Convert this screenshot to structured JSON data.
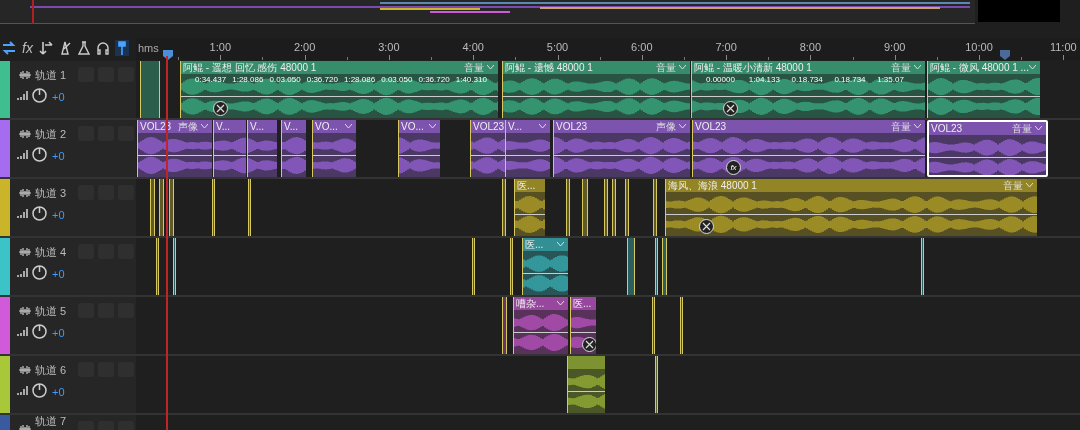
{
  "toolbar": {
    "fx_label": "fx"
  },
  "ruler": {
    "unit": "hms",
    "ticks": [
      "1:00",
      "2:00",
      "3:00",
      "4:00",
      "5:00",
      "6:00",
      "7:00",
      "8:00",
      "9:00",
      "10:00",
      "11:00"
    ]
  },
  "tracks": [
    {
      "name": "轨道 1",
      "color": "#3fbf8f",
      "volume": "+0",
      "clips": [
        {
          "label": "阿鲲 - 遥想 回忆 感伤 48000 1",
          "control": "音量",
          "selected": false,
          "markers": [
            "0:34.437",
            "1:28.086",
            "0.03.050",
            "0:36.720",
            "1:28.086",
            "0.03.050",
            "0:36.720",
            "1:40.310"
          ]
        },
        {
          "label": "阿鲲 - 遗憾 48000 1",
          "control": "音量",
          "selected": false
        },
        {
          "label": "阿鲲 - 温暖小清新 48000 1",
          "control": "音量",
          "selected": false,
          "markers": [
            "0.00000",
            "1:04.133",
            "0.18.734",
            "0.18.734",
            "1:35.07"
          ]
        },
        {
          "label": "阿鲲 - 微风 48000 1 ...",
          "selected": false
        }
      ]
    },
    {
      "name": "轨道 2",
      "color": "#a66cf0",
      "volume": "+0",
      "clips": [
        {
          "label": "VOL23",
          "control": "声像",
          "selected": false
        },
        {
          "label": "V...",
          "selected": false
        },
        {
          "label": "V...",
          "selected": false
        },
        {
          "label": "V...",
          "selected": false
        },
        {
          "label": "VO...",
          "selected": false
        },
        {
          "label": "VO...",
          "selected": false
        },
        {
          "label": "VOL23",
          "selected": false
        },
        {
          "label": "V...",
          "selected": false
        },
        {
          "label": "VOL23",
          "control": "声像",
          "selected": false
        },
        {
          "label": "VOL23",
          "control": "音量",
          "selected": false,
          "badge": "fx"
        },
        {
          "label": "VOL23",
          "control": "音量",
          "selected": true
        }
      ]
    },
    {
      "name": "轨道 3",
      "color": "#c9b42a",
      "volume": "+0",
      "clips": [
        {
          "label": "医...",
          "selected": false
        },
        {
          "label": "海风、海浪 48000 1",
          "control": "音量",
          "selected": false
        }
      ]
    },
    {
      "name": "轨道 4",
      "color": "#3cc3c8",
      "volume": "+0",
      "clips": [
        {
          "label": "医...",
          "selected": false
        }
      ]
    },
    {
      "name": "轨道 5",
      "color": "#d05ad8",
      "volume": "+0",
      "clips": [
        {
          "label": "嘈杂...",
          "selected": false
        },
        {
          "label": "医...",
          "selected": false
        }
      ]
    },
    {
      "name": "轨道 6",
      "color": "#a8c83a",
      "volume": "+0",
      "clips": [
        {
          "selected": false
        }
      ]
    },
    {
      "name": "轨道 7",
      "color": "#3a5aa0"
    }
  ]
}
